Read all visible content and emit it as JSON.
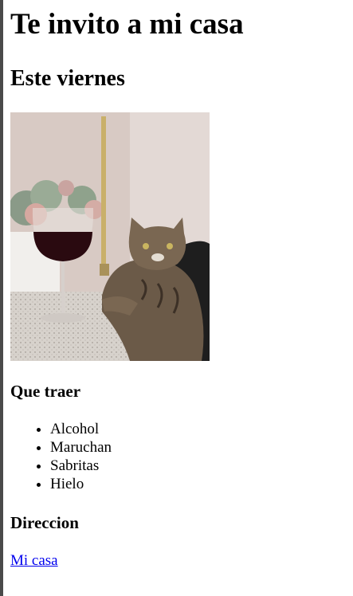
{
  "page": {
    "title": "Te invito a mi casa",
    "subtitle": "Este viernes",
    "bring_heading": "Que traer",
    "bring_items": [
      "Alcohol",
      "Maruchan",
      "Sabritas",
      "Hielo"
    ],
    "address_heading": "Direccion",
    "address_link": "Mi casa"
  },
  "colors": {
    "link": "#0000ee",
    "text": "#000000",
    "background": "#ffffff"
  }
}
